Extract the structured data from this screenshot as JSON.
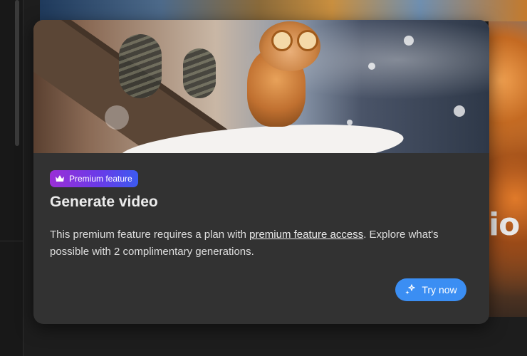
{
  "modal": {
    "badge_label": "Premium feature",
    "badge_icon": "crown-icon",
    "title": "Generate video",
    "description_before": "This premium feature requires a plan with ",
    "description_link": "premium feature access",
    "description_after": ". Explore what's possible with 2 complimentary generations.",
    "cta_label": "Try now",
    "cta_icon": "sparkle-icon"
  },
  "background": {
    "partial_word": "io"
  },
  "colors": {
    "card_bg": "#323232",
    "page_bg": "#1d1d1d",
    "badge_gradient_start": "#9a2fd6",
    "badge_gradient_end": "#3c5bf0",
    "cta_bg": "#3b8ef3",
    "title_text": "#ececec"
  }
}
